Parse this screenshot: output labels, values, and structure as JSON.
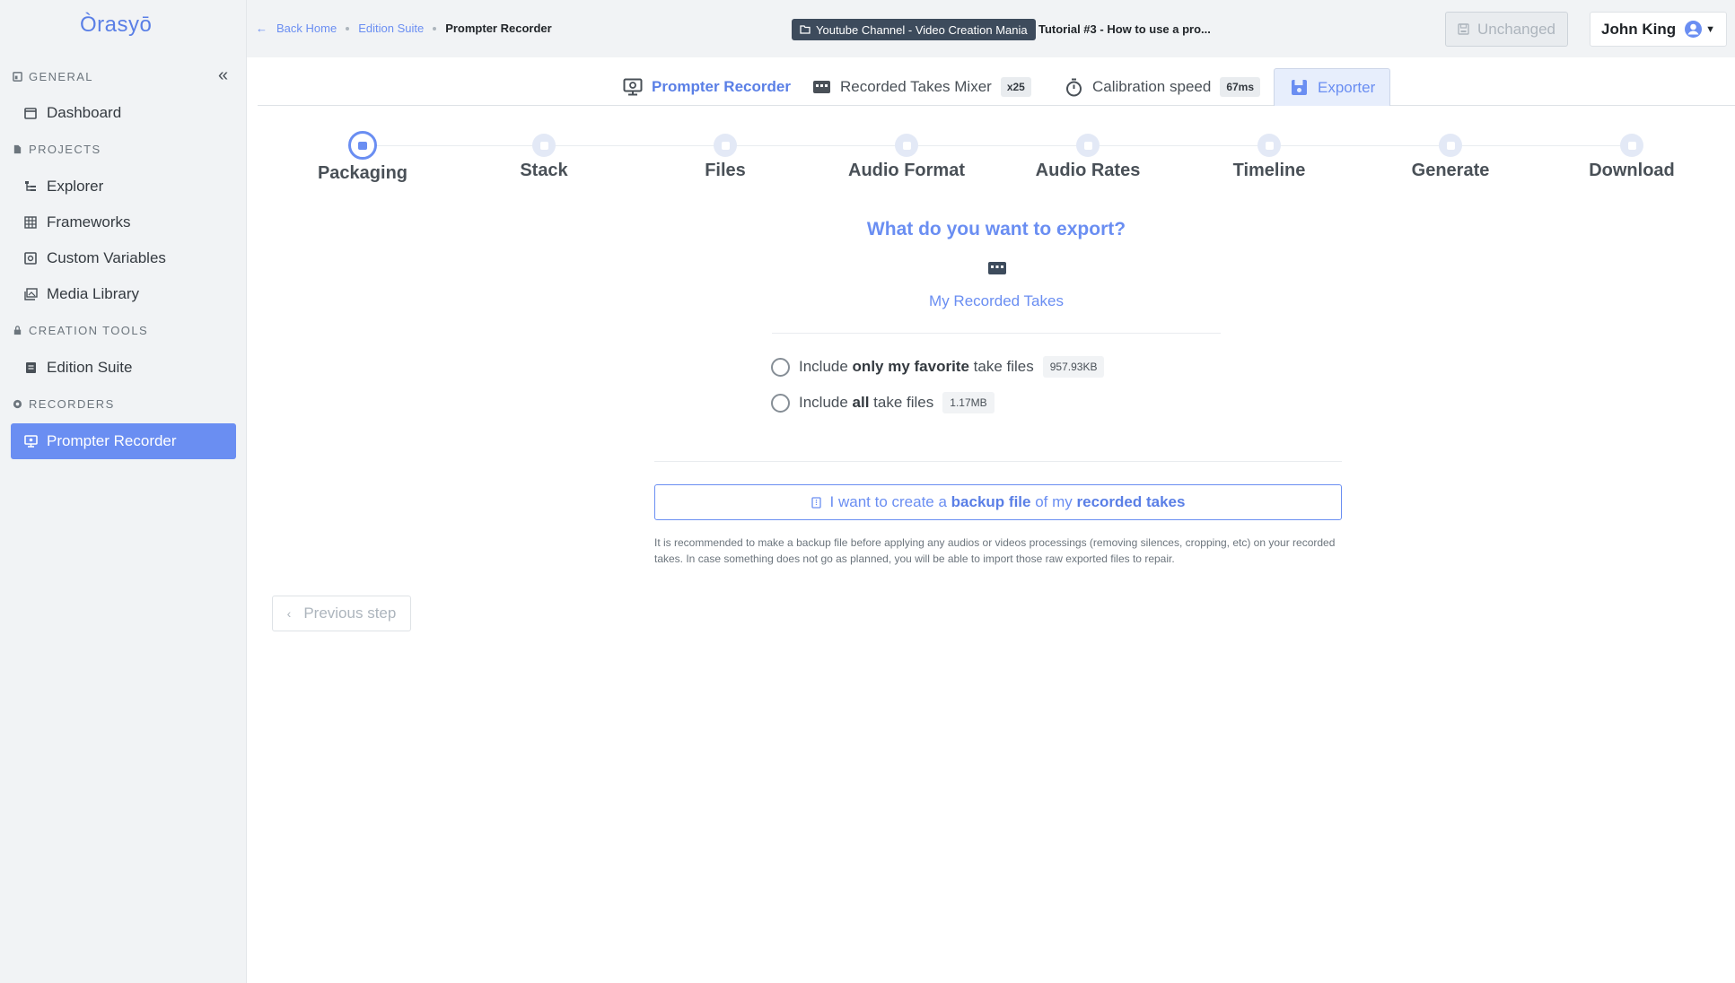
{
  "app": {
    "logo": "Òrasyō"
  },
  "sidebar": {
    "collapse_icon": "double-chevron-left-icon",
    "sections": [
      {
        "title": "GENERAL",
        "icon": "dashboard-icon"
      },
      {
        "title": "PROJECTS",
        "icon": "file-icon"
      },
      {
        "title": "CREATION TOOLS",
        "icon": "lock-icon"
      },
      {
        "title": "RECORDERS",
        "icon": "record-icon"
      }
    ],
    "items": [
      {
        "label": "Dashboard",
        "icon": "window-icon"
      },
      {
        "label": "Explorer",
        "icon": "tree-icon"
      },
      {
        "label": "Frameworks",
        "icon": "grid-icon"
      },
      {
        "label": "Custom Variables",
        "icon": "variable-icon"
      },
      {
        "label": "Media Library",
        "icon": "images-icon"
      },
      {
        "label": "Edition Suite",
        "icon": "book-icon"
      },
      {
        "label": "Prompter Recorder",
        "icon": "monitor-icon",
        "active": true
      }
    ]
  },
  "header": {
    "breadcrumb": {
      "back": "Back Home",
      "parent": "Edition Suite",
      "current": "Prompter Recorder"
    },
    "channel": "Youtube Channel - Video Creation Mania",
    "tutorial_title": "Tutorial #3 - How to use a pro...",
    "save_status": "Unchanged",
    "user_name": "John King"
  },
  "tabs": {
    "prompter": "Prompter Recorder",
    "mixer": "Recorded Takes Mixer",
    "mixer_count": "x25",
    "calibration": "Calibration speed",
    "calibration_value": "67ms",
    "exporter": "Exporter"
  },
  "stepper": {
    "steps": [
      "Packaging",
      "Stack",
      "Files",
      "Audio Format",
      "Audio Rates",
      "Timeline",
      "Generate",
      "Download"
    ],
    "active_index": 0
  },
  "export": {
    "question": "What do you want to export?",
    "target_label": "My Recorded Takes",
    "option1": {
      "prefix": "Include ",
      "bold": "only my favorite",
      "suffix": " take files",
      "size": "957.93KB"
    },
    "option2": {
      "prefix": "Include ",
      "bold": "all",
      "suffix": " take files",
      "size": "1.17MB"
    },
    "backup": {
      "part1": "I want to create a ",
      "bold1": "backup file",
      "part2": " of my ",
      "bold2": "recorded takes"
    },
    "help_text": "It is recommended to make a backup file before applying any audios or videos processings (removing silences, cropping, etc) on your recorded takes. In case something does not go as planned, you will be able to import those raw exported files to repair.",
    "prev_step": "Previous step"
  },
  "colors": {
    "accent": "#6a8ef2",
    "sidebar_bg": "#f1f3f5",
    "badge_dark": "#3d4b5c"
  }
}
